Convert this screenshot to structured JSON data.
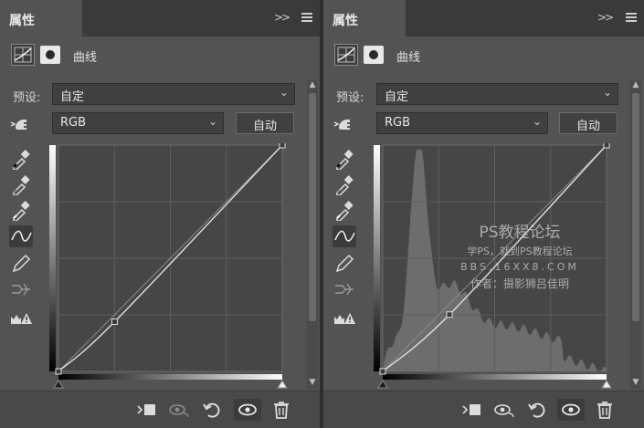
{
  "panels": [
    {
      "tab_label": "属性",
      "adjustment_name": "曲线",
      "preset_label": "预设:",
      "preset_value": "自定",
      "channel_value": "RGB",
      "auto_label": "自动",
      "curve_points": [
        [
          0,
          0
        ],
        [
          64,
          56
        ],
        [
          255,
          255
        ]
      ],
      "show_histogram": false
    },
    {
      "tab_label": "属性",
      "adjustment_name": "曲线",
      "preset_label": "预设:",
      "preset_value": "自定",
      "channel_value": "RGB",
      "auto_label": "自动",
      "curve_points": [
        [
          0,
          0
        ],
        [
          76,
          64
        ],
        [
          255,
          255
        ]
      ],
      "show_histogram": true,
      "watermark": {
        "line1": "PS教程论坛",
        "line2": "学PS，就到PS教程论坛",
        "line3": "BBS.16XX8.COM",
        "line4": "作者：摄影狮吕佳明"
      }
    }
  ],
  "colors": {
    "panel_bg": "#535353",
    "graph_bg": "#464646",
    "grid": "#5e5e5e",
    "curve": "#e0e0e0",
    "histogram": "#6d6d6d"
  },
  "icons": {
    "collapse": "double-chevron-right-icon",
    "menu": "hamburger-menu-icon",
    "curves_panel": "curves-adjustment-icon",
    "mask": "layer-mask-icon",
    "target_adjust": "on-image-adjust-hand-icon",
    "black_point": "black-point-eyedropper-icon",
    "gray_point": "gray-point-eyedropper-icon",
    "white_point": "white-point-eyedropper-icon",
    "curve_tool": "edit-curve-points-icon",
    "pencil_tool": "pencil-draw-curve-icon",
    "smooth": "smooth-curve-icon",
    "clipping": "clipping-warning-icon",
    "clip_to_layer": "clip-to-layer-icon",
    "view_previous": "view-previous-state-icon",
    "reset": "reset-icon",
    "visibility": "eye-icon",
    "delete": "trash-icon"
  }
}
